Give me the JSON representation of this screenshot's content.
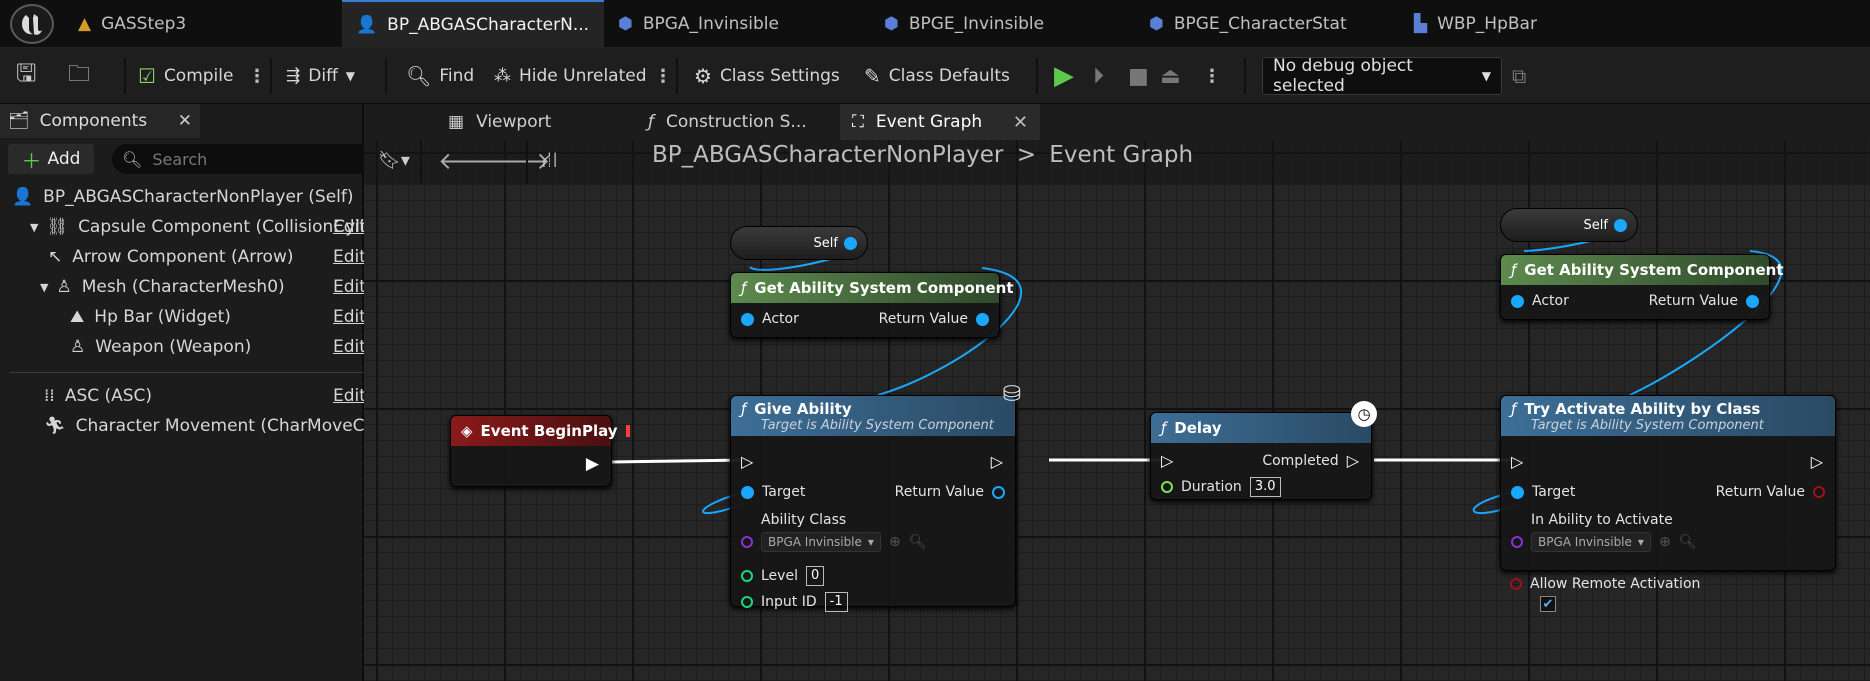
{
  "doc_tabs": [
    {
      "label": "GASStep3",
      "icon": "level-icon"
    },
    {
      "label": "BP_ABGASCharacterN...",
      "icon": "character-blueprint-icon",
      "active": true
    },
    {
      "label": "BPGA_Invinsible",
      "icon": "blueprint-icon"
    },
    {
      "label": "BPGE_Invinsible",
      "icon": "blueprint-icon"
    },
    {
      "label": "BPGE_CharacterStat",
      "icon": "blueprint-icon"
    },
    {
      "label": "WBP_HpBar",
      "icon": "widget-blueprint-icon"
    }
  ],
  "toolbar": {
    "compile": "Compile",
    "diff": "Diff",
    "find": "Find",
    "hide_unrelated": "Hide Unrelated",
    "class_settings": "Class Settings",
    "class_defaults": "Class Defaults",
    "debug_object": "No debug object selected"
  },
  "components_panel": {
    "title": "Components",
    "add": "Add",
    "search_placeholder": "Search",
    "edit_label": "Edit in C++",
    "edit_cut": "Edit i",
    "items": [
      {
        "label": "BP_ABGASCharacterNonPlayer (Self)"
      },
      {
        "label": "Capsule Component (CollisionCylinder)"
      },
      {
        "label": "Arrow Component (Arrow)"
      },
      {
        "label": "Mesh (CharacterMesh0)"
      },
      {
        "label": "Hp Bar (Widget)"
      },
      {
        "label": "Weapon (Weapon)"
      },
      {
        "label": "ASC (ASC)"
      },
      {
        "label": "Character Movement (CharMoveComp)"
      }
    ]
  },
  "graph_tabs": [
    {
      "label": "Viewport"
    },
    {
      "label": "Construction S..."
    },
    {
      "label": "Event Graph"
    }
  ],
  "breadcrumb": {
    "blueprint": "BP_ABGASCharacterNonPlayer",
    "separator": ">",
    "graph": "Event Graph"
  },
  "nodes": {
    "self_label": "Self",
    "get_asc_title": "Get Ability System Component",
    "actor": "Actor",
    "return_value": "Return Value",
    "event_begin_play": "Event BeginPlay",
    "give_ability": {
      "title": "Give Ability",
      "subtitle": "Target is Ability System Component",
      "target": "Target",
      "ability_class": "Ability Class",
      "ability_value": "BPGA Invinsible",
      "level": "Level",
      "level_value": "0",
      "input_id": "Input ID",
      "input_id_value": "-1"
    },
    "delay": {
      "title": "Delay",
      "completed": "Completed",
      "duration": "Duration",
      "duration_value": "3.0"
    },
    "try_activate": {
      "title": "Try Activate Ability by Class",
      "subtitle": "Target is Ability System Component",
      "target": "Target",
      "in_ability": "In Ability to Activate",
      "ability_value": "BPGA Invinsible",
      "allow_remote": "Allow Remote Activation"
    }
  },
  "colors": {
    "exec_wire": "#ffffff",
    "object_wire": "#1aa8ff",
    "function_header": "#3d6e96",
    "pure_header": "#5d8a4f",
    "event_header": "#8a1a1a"
  }
}
